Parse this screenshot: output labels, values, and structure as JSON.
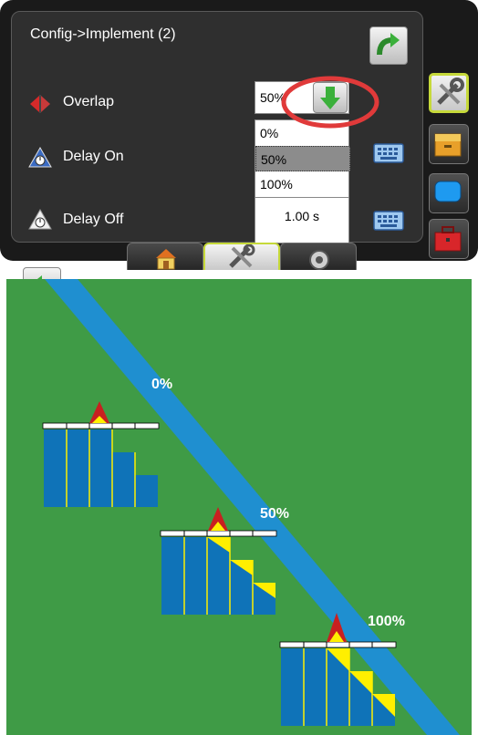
{
  "screen": {
    "title": "Config->Implement (2)",
    "rows": [
      {
        "label": "Overlap",
        "value": "50%"
      },
      {
        "label": "Delay On"
      },
      {
        "label": "Delay Off",
        "value": "1.00 s"
      }
    ],
    "overlap_dropdown": {
      "options": [
        "0%",
        "50%",
        "100%"
      ],
      "selected": "50%"
    },
    "side_panel": [
      "tools-icon",
      "storage-icon",
      "display-icon",
      "toolbox-icon"
    ],
    "bottom_tabs": [
      "home-icon",
      "tools-icon",
      "gps-icon"
    ],
    "active_tab": "tools-icon",
    "highlight_color": "#e03a3a",
    "accent_color": "#c6d93a"
  },
  "diagram": {
    "labels": [
      "0%",
      "50%",
      "100%"
    ],
    "background_color": "#3f9b46",
    "guideline_color": "#1f8fd0",
    "section_color": "#0f73b8",
    "overlap_color": "#ffef00"
  }
}
